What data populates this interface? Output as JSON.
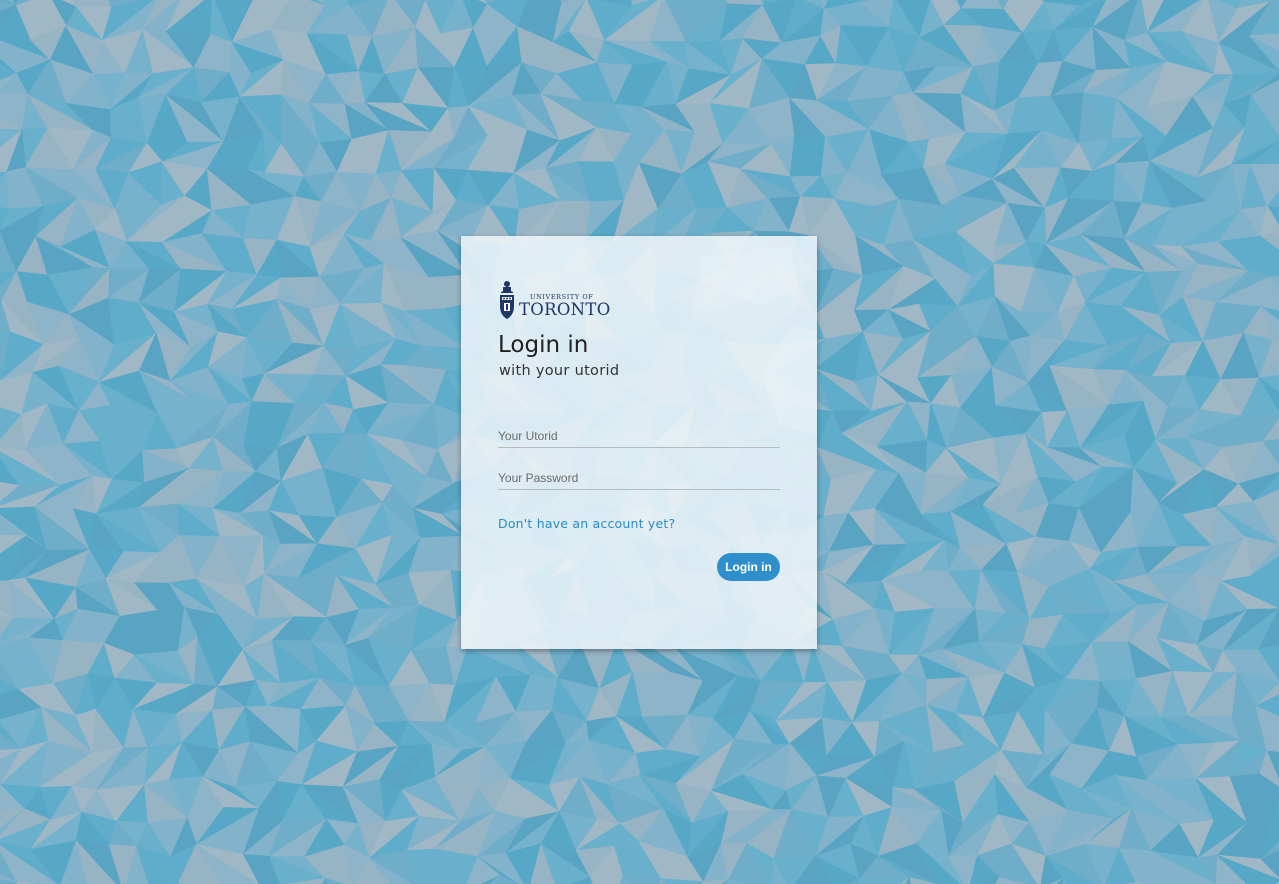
{
  "logo": {
    "line1": "UNIVERSITY OF",
    "line2": "TORONTO"
  },
  "login": {
    "title": "Login in",
    "subtitle": "with your utorid",
    "utorid_placeholder": "Your Utorid",
    "password_placeholder": "Your Password",
    "signup_link": "Don't have an account yet?",
    "submit_label": "Login in"
  },
  "colors": {
    "background_teal": "#57a8c7",
    "background_grey": "#95b2c4",
    "card_background": "#ecf4f8",
    "accent": "#2e8fcc",
    "logo_navy": "#1e3765"
  }
}
